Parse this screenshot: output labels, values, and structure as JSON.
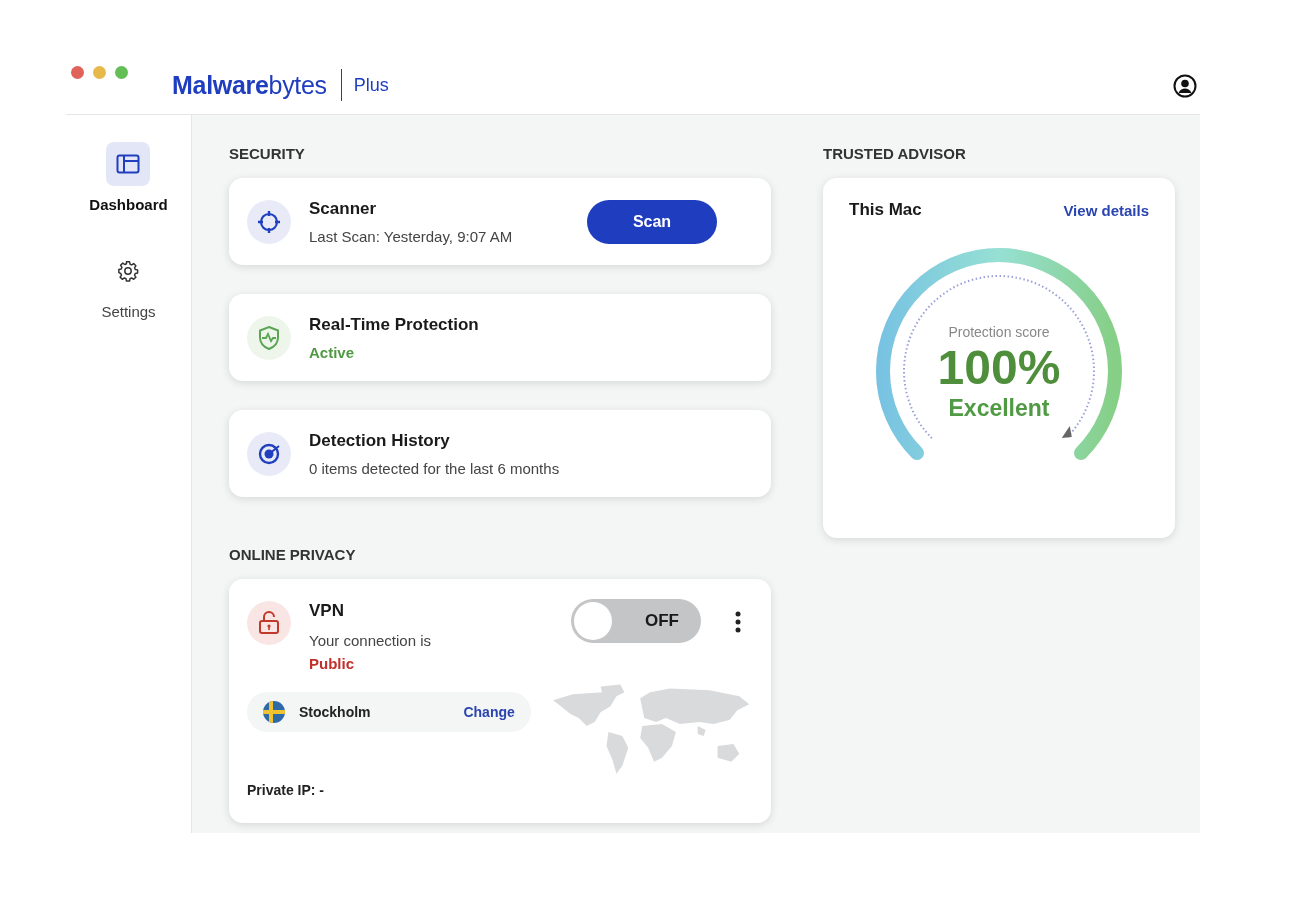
{
  "header": {
    "brand": "**Malware**bytes",
    "plan": "Plus"
  },
  "sidebar": {
    "items": [
      {
        "kind": "dashboard",
        "label": "Dashboard",
        "selected": true
      },
      {
        "kind": "settings",
        "label": "Settings",
        "selected": false
      }
    ]
  },
  "security": {
    "heading": "SECURITY",
    "cards": [
      {
        "kind": "scanner",
        "title": "Scanner",
        "detail": "Last Scan: Yesterday, 9:07 AM",
        "button": "Scan"
      },
      {
        "kind": "protection",
        "title": "Real-Time Protection",
        "status": "Active",
        "warning": false
      },
      {
        "kind": "history",
        "title": "Detection History",
        "detail": "0 items detected for the last 6 months"
      }
    ]
  },
  "privacy": {
    "heading": "ONLINE PRIVACY",
    "vpn": {
      "title": "VPN",
      "detail": "Your connection is",
      "status": "Public",
      "warning": true,
      "on": false,
      "toggle_label": "OFF",
      "location": "Stockholm",
      "change": "Change",
      "private_ip": "Private IP: -"
    }
  },
  "trusted_advisor": {
    "heading": "TRUSTED ADVISOR",
    "device": "This Mac",
    "link": "View details",
    "gauge": {
      "caption": "Protection score",
      "value": "100%",
      "rating": "Excellent",
      "level": 1
    }
  }
}
